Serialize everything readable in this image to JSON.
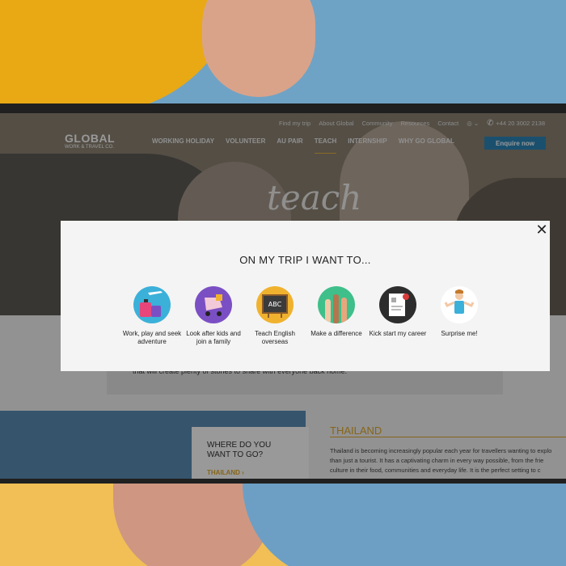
{
  "topnav": {
    "links": [
      "Find my trip",
      "About Global",
      "Community",
      "Resources",
      "Contact"
    ],
    "phone": "+44 20 3002 2138"
  },
  "logo": {
    "line1": "GLOBAL",
    "line2": "WORK & TRAVEL CO."
  },
  "mainnav": [
    "WORKING HOLIDAY",
    "VOLUNTEER",
    "AU PAIR",
    "TEACH",
    "INTERNSHIP",
    "WHY GO GLOBAL"
  ],
  "enquire_label": "Enquire now",
  "hero_word": "teach",
  "content_text": "that will create plenty of stories to share with everyone back home.",
  "where": {
    "title": "WHERE DO YOU WANT TO GO?",
    "link": "THAILAND"
  },
  "thailand": {
    "title": "THAILAND",
    "lines": [
      "Thailand is becoming increasingly popular each year for travellers wanting to explo",
      "than just a tourist. It has a captivating charm in every way possible, from the frie",
      "culture in their food, communities and everyday life. It is the perfect setting to c"
    ]
  },
  "modal": {
    "title": "ON MY TRIP I WANT TO...",
    "close_icon": "close-icon",
    "options": [
      {
        "label": "Work, play and seek adventure",
        "icon": "luggage-plane-icon",
        "color": "#3bb0d9"
      },
      {
        "label": "Look after kids and join a family",
        "icon": "pram-icon",
        "color": "#7b4fc4"
      },
      {
        "label": "Teach English overseas",
        "icon": "chalkboard-icon",
        "color": "#f0b22e"
      },
      {
        "label": "Make a difference",
        "icon": "raised-hands-icon",
        "color": "#3fbf8a"
      },
      {
        "label": "Kick start my career",
        "icon": "certificate-icon",
        "color": "#2d2d2d"
      },
      {
        "label": "Surprise me!",
        "icon": "shrug-person-icon",
        "color": "#ffffff"
      }
    ]
  }
}
